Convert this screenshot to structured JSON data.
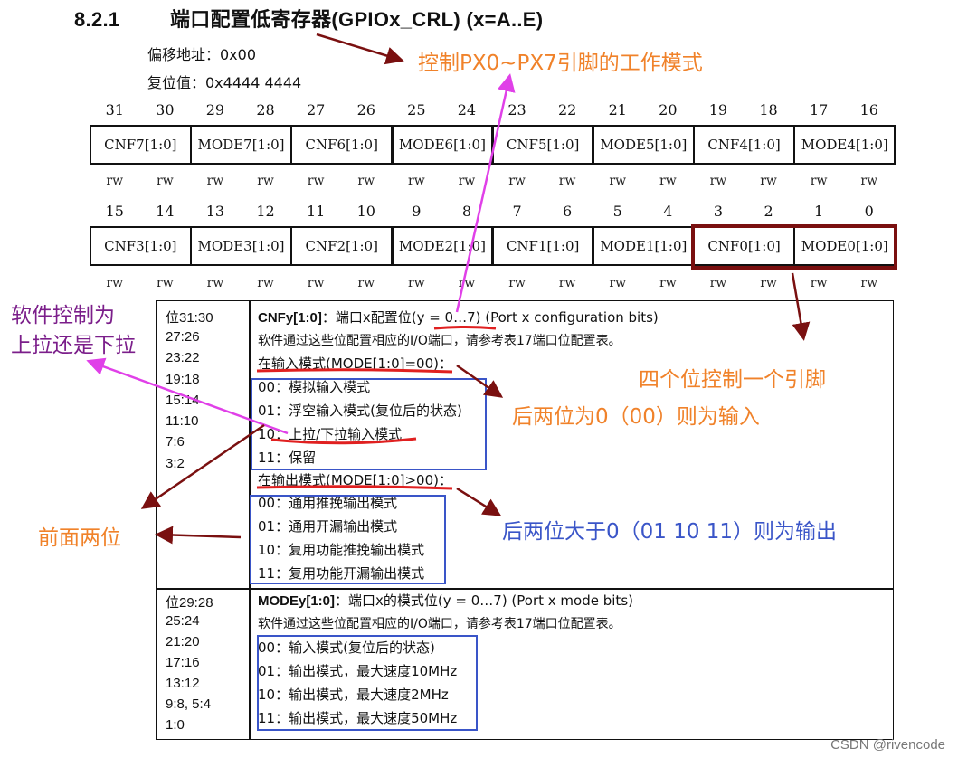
{
  "heading": {
    "number": "8.2.1",
    "title": "端口配置低寄存器(GPIOx_CRL) (x=A..E)"
  },
  "offset": "偏移地址：0x00",
  "reset": "复位值：0x4444 4444",
  "upper_bits": [
    "31",
    "30",
    "29",
    "28",
    "27",
    "26",
    "25",
    "24",
    "23",
    "22",
    "21",
    "20",
    "19",
    "18",
    "17",
    "16"
  ],
  "lower_bits": [
    "15",
    "14",
    "13",
    "12",
    "11",
    "10",
    "9",
    "8",
    "7",
    "6",
    "5",
    "4",
    "3",
    "2",
    "1",
    "0"
  ],
  "upper_fields": [
    "CNF7[1:0]",
    "MODE7[1:0]",
    "CNF6[1:0]",
    "MODE6[1:0]",
    "CNF5[1:0]",
    "MODE5[1:0]",
    "CNF4[1:0]",
    "MODE4[1:0]"
  ],
  "lower_fields": [
    "CNF3[1:0]",
    "MODE3[1:0]",
    "CNF2[1:0]",
    "MODE2[1:0]",
    "CNF1[1:0]",
    "MODE1[1:0]",
    "CNF0[1:0]",
    "MODE0[1:0]"
  ],
  "access": "rw",
  "cnf": {
    "bits": [
      "位31:30",
      "27:26",
      "23:22",
      "19:18",
      "15:14",
      "11:10",
      "7:6",
      "3:2"
    ],
    "title_bold": "CNFy[1:0]",
    "title_rest": "：端口x配置位(y = 0…7) (Port x configuration bits)",
    "desc": "软件通过这些位配置相应的I/O端口，请参考表17端口位配置表。",
    "input_mode": "在输入模式(MODE[1:0]=00)：",
    "input_items": [
      "00：模拟输入模式",
      "01：浮空输入模式(复位后的状态)",
      "10：上拉/下拉输入模式",
      "11：保留"
    ],
    "output_mode": "在输出模式(MODE[1:0]>00)：",
    "output_items": [
      "00：通用推挽输出模式",
      "01：通用开漏输出模式",
      "10：复用功能推挽输出模式",
      "11：复用功能开漏输出模式"
    ]
  },
  "mode": {
    "bits": [
      "位29:28",
      "25:24",
      "21:20",
      "17:16",
      "13:12",
      "9:8, 5:4",
      "1:0"
    ],
    "title_bold": "MODEy[1:0]",
    "title_rest": "：端口x的模式位(y = 0…7) (Port x mode bits)",
    "desc": "软件通过这些位配置相应的I/O端口，请参考表17端口位配置表。",
    "items": [
      "00：输入模式(复位后的状态)",
      "01：输出模式，最大速度10MHz",
      "10：输出模式，最大速度2MHz",
      "11：输出模式，最大速度50MHz"
    ]
  },
  "annotations": {
    "px_pins": "控制PX0~PX7引脚的工作模式",
    "four_bits": "四个位控制一个引脚",
    "input_rule": "后两位为0（00）则为输入",
    "output_rule": "后两位大于0（01 10 11）则为输出",
    "front_two": "前面两位",
    "pull_line1": "软件控制为",
    "pull_line2": "上拉还是下拉"
  },
  "colors": {
    "orange": "#f0822a",
    "blue": "#3a55c8",
    "purple": "#7b1e8a",
    "darkred": "#7a1010",
    "magenta": "#e040e8",
    "red": "#e02020"
  },
  "watermark": "CSDN @rivencode"
}
